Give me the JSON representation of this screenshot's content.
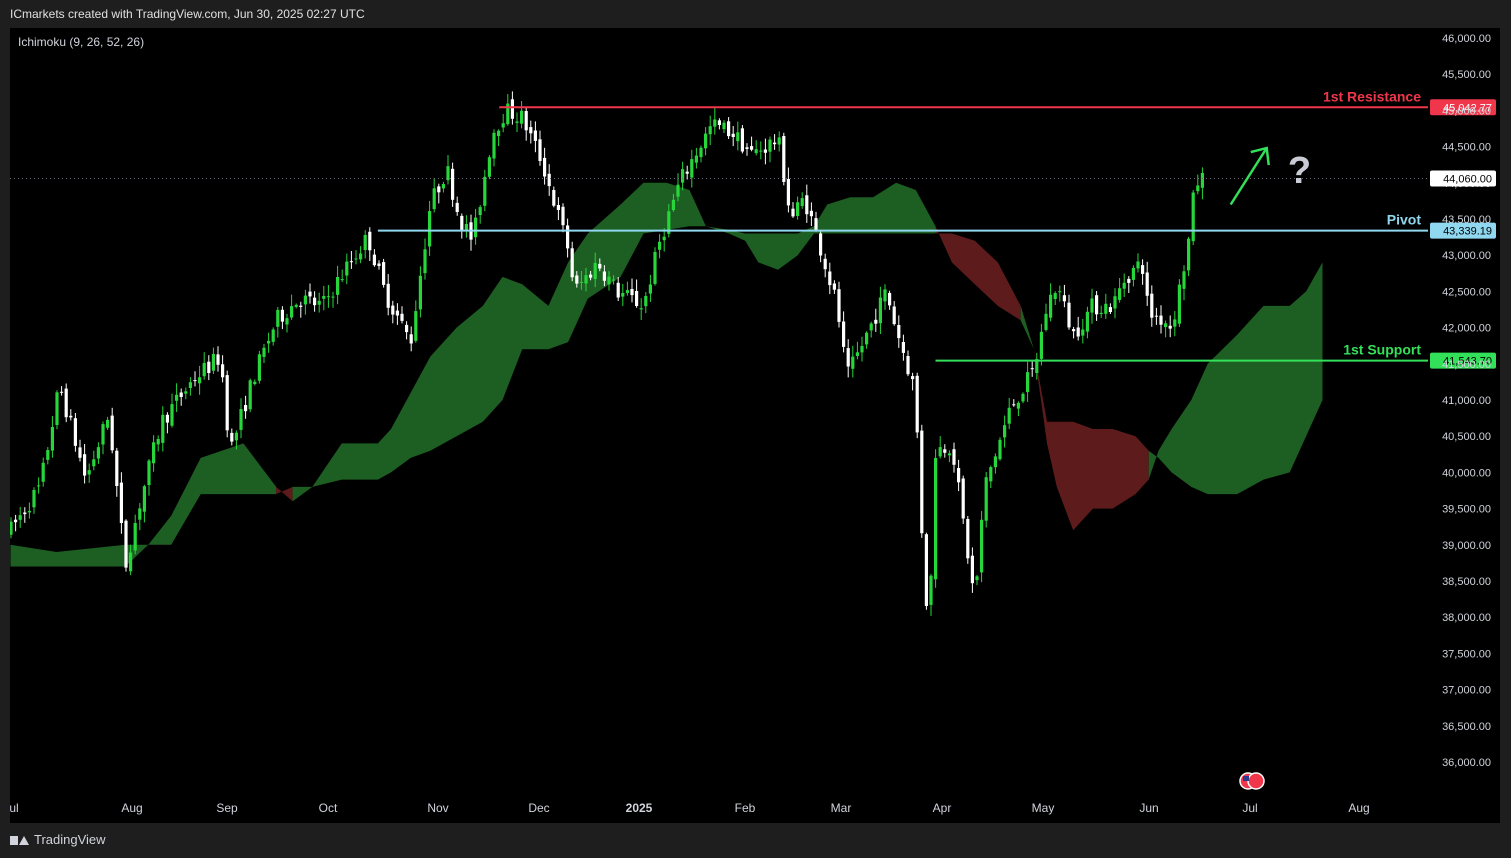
{
  "header": {
    "credit": "ICmarkets created with TradingView.com, Jun 30, 2025 02:27 UTC"
  },
  "footer": {
    "brand": "TradingView"
  },
  "icons": {
    "brand": "tradingview-logo-icon",
    "event": "us-flag-event-icon",
    "annotation": "question-mark-icon"
  },
  "colors": {
    "background": "#000000",
    "bull_candle": "#26d63a",
    "bear_candle": "#ffffff",
    "cloud_bull": "#1d5e22",
    "cloud_bear": "#5e1b1b",
    "resistance": "#f0364a",
    "pivot": "#8fd8f0",
    "support": "#33e05a",
    "arrow": "#33e05a"
  },
  "chart_data": {
    "type": "candlestick",
    "indicator": "Ichimoku (9, 26, 52, 26)",
    "ylim": [
      35700,
      46000
    ],
    "y_ticks": [
      "46,000.00",
      "45,500.00",
      "45,000.00",
      "44,500.00",
      "44,000.00",
      "43,500.00",
      "43,000.00",
      "42,500.00",
      "42,000.00",
      "41,500.00",
      "41,000.00",
      "40,500.00",
      "40,000.00",
      "39,500.00",
      "39,000.00",
      "38,500.00",
      "38,000.00",
      "37,500.00",
      "37,000.00",
      "36,500.00",
      "36,000.00"
    ],
    "x_ticks": [
      "Jul",
      "Aug",
      "Sep",
      "Oct",
      "Nov",
      "Dec",
      "2025",
      "Feb",
      "Mar",
      "Apr",
      "May",
      "Jun",
      "Jul",
      "Aug"
    ],
    "last_price": {
      "value": 44060,
      "label": "44,060.00"
    },
    "levels": [
      {
        "name": "1st Resistance",
        "value": 45042.77,
        "label": "45,042.77",
        "start_date": "2024-11-27"
      },
      {
        "name": "Pivot",
        "value": 43339.19,
        "label": "43,339.19",
        "start_date": "2024-10-21"
      },
      {
        "name": "1st Support",
        "value": 41543.7,
        "label": "41,543.70",
        "start_date": "2025-04-09"
      }
    ],
    "annotations": [
      {
        "type": "arrow",
        "from": [
          "2025-07-08",
          43700
        ],
        "to": [
          "2025-07-19",
          44480
        ]
      },
      {
        "type": "text",
        "text": "?",
        "at": [
          "2025-07-29",
          44000
        ]
      }
    ],
    "price_path": [
      [
        "2024-07-01",
        39200
      ],
      [
        "2024-07-10",
        39800
      ],
      [
        "2024-07-16",
        41200
      ],
      [
        "2024-07-24",
        39900
      ],
      [
        "2024-07-31",
        40800
      ],
      [
        "2024-08-05",
        38700
      ],
      [
        "2024-08-09",
        39500
      ],
      [
        "2024-08-16",
        40700
      ],
      [
        "2024-08-26",
        41300
      ],
      [
        "2024-09-03",
        41600
      ],
      [
        "2024-09-06",
        40300
      ],
      [
        "2024-09-13",
        41300
      ],
      [
        "2024-09-20",
        42100
      ],
      [
        "2024-09-27",
        42400
      ],
      [
        "2024-10-04",
        42300
      ],
      [
        "2024-10-11",
        42800
      ],
      [
        "2024-10-18",
        43250
      ],
      [
        "2024-10-23",
        42500
      ],
      [
        "2024-10-31",
        41800
      ],
      [
        "2024-11-06",
        43700
      ],
      [
        "2024-11-11",
        44200
      ],
      [
        "2024-11-15",
        43500
      ],
      [
        "2024-11-19",
        43200
      ],
      [
        "2024-11-25",
        44700
      ],
      [
        "2024-11-29",
        45000
      ],
      [
        "2024-12-04",
        44900
      ],
      [
        "2024-12-10",
        44300
      ],
      [
        "2024-12-18",
        43100
      ],
      [
        "2024-12-20",
        42500
      ],
      [
        "2024-12-27",
        42900
      ],
      [
        "2025-01-02",
        42500
      ],
      [
        "2025-01-10",
        42300
      ],
      [
        "2025-01-15",
        43200
      ],
      [
        "2025-01-21",
        44000
      ],
      [
        "2025-01-27",
        44500
      ],
      [
        "2025-01-31",
        44800
      ],
      [
        "2025-02-06",
        44700
      ],
      [
        "2025-02-12",
        44400
      ],
      [
        "2025-02-20",
        44600
      ],
      [
        "2025-02-24",
        43500
      ],
      [
        "2025-02-28",
        43800
      ],
      [
        "2025-03-05",
        43100
      ],
      [
        "2025-03-10",
        42300
      ],
      [
        "2025-03-13",
        41300
      ],
      [
        "2025-03-19",
        41900
      ],
      [
        "2025-03-25",
        42500
      ],
      [
        "2025-03-28",
        42000
      ],
      [
        "2025-04-03",
        41100
      ],
      [
        "2025-04-04",
        39800
      ],
      [
        "2025-04-07",
        37700
      ],
      [
        "2025-04-09",
        40300
      ],
      [
        "2025-04-14",
        40400
      ],
      [
        "2025-04-21",
        38200
      ],
      [
        "2025-04-24",
        39800
      ],
      [
        "2025-05-02",
        40900
      ],
      [
        "2025-05-09",
        41400
      ],
      [
        "2025-05-13",
        42300
      ],
      [
        "2025-05-16",
        42600
      ],
      [
        "2025-05-21",
        41900
      ],
      [
        "2025-05-27",
        42300
      ],
      [
        "2025-06-02",
        42300
      ],
      [
        "2025-06-06",
        42700
      ],
      [
        "2025-06-11",
        42900
      ],
      [
        "2025-06-13",
        42200
      ],
      [
        "2025-06-18",
        42100
      ],
      [
        "2025-06-20",
        42000
      ],
      [
        "2025-06-24",
        42900
      ],
      [
        "2025-06-26",
        43400
      ],
      [
        "2025-06-27",
        44000
      ],
      [
        "2025-06-30",
        44060
      ]
    ],
    "cloud": [
      {
        "date": "2024-07-01",
        "a": 39000,
        "b": 38700
      },
      {
        "date": "2024-07-15",
        "a": 38900,
        "b": 38700
      },
      {
        "date": "2024-08-05",
        "a": 39000,
        "b": 38700
      },
      {
        "date": "2024-08-12",
        "a": 39000,
        "b": 39000
      },
      {
        "date": "2024-08-19",
        "a": 39400,
        "b": 39000
      },
      {
        "date": "2024-08-28",
        "a": 40200,
        "b": 39700
      },
      {
        "date": "2024-09-10",
        "a": 40400,
        "b": 39700
      },
      {
        "date": "2024-09-20",
        "a": 39800,
        "b": 39700
      },
      {
        "date": "2024-09-25",
        "a": 39600,
        "b": 39800
      },
      {
        "date": "2024-10-01",
        "a": 39800,
        "b": 39800
      },
      {
        "date": "2024-10-10",
        "a": 40400,
        "b": 39900
      },
      {
        "date": "2024-10-21",
        "a": 40400,
        "b": 39900
      },
      {
        "date": "2024-10-25",
        "a": 40600,
        "b": 40000
      },
      {
        "date": "2024-10-31",
        "a": 41100,
        "b": 40200
      },
      {
        "date": "2024-11-06",
        "a": 41600,
        "b": 40300
      },
      {
        "date": "2024-11-14",
        "a": 42000,
        "b": 40500
      },
      {
        "date": "2024-11-22",
        "a": 42300,
        "b": 40700
      },
      {
        "date": "2024-11-28",
        "a": 42700,
        "b": 41000
      },
      {
        "date": "2024-12-04",
        "a": 42600,
        "b": 41700
      },
      {
        "date": "2024-12-12",
        "a": 42300,
        "b": 41700
      },
      {
        "date": "2024-12-18",
        "a": 42900,
        "b": 41800
      },
      {
        "date": "2024-12-24",
        "a": 43300,
        "b": 42400
      },
      {
        "date": "2025-01-03",
        "a": 43700,
        "b": 42700
      },
      {
        "date": "2025-01-10",
        "a": 44000,
        "b": 43300
      },
      {
        "date": "2025-01-17",
        "a": 44000,
        "b": 43350
      },
      {
        "date": "2025-01-24",
        "a": 43900,
        "b": 43400
      },
      {
        "date": "2025-01-29",
        "a": 43400,
        "b": 43400
      },
      {
        "date": "2025-02-05",
        "a": 43350,
        "b": 43300
      },
      {
        "date": "2025-02-10",
        "a": 43300,
        "b": 43200
      },
      {
        "date": "2025-02-14",
        "a": 43300,
        "b": 42900
      },
      {
        "date": "2025-02-20",
        "a": 43300,
        "b": 42800
      },
      {
        "date": "2025-02-26",
        "a": 43300,
        "b": 43000
      },
      {
        "date": "2025-03-03",
        "a": 43400,
        "b": 43300
      },
      {
        "date": "2025-03-07",
        "a": 43700,
        "b": 43300
      },
      {
        "date": "2025-03-14",
        "a": 43800,
        "b": 43300
      },
      {
        "date": "2025-03-21",
        "a": 43800,
        "b": 43300
      },
      {
        "date": "2025-03-28",
        "a": 44000,
        "b": 43300
      },
      {
        "date": "2025-04-03",
        "a": 43900,
        "b": 43300
      },
      {
        "date": "2025-04-09",
        "a": 43400,
        "b": 43300
      },
      {
        "date": "2025-04-14",
        "a": 42900,
        "b": 43300
      },
      {
        "date": "2025-04-21",
        "a": 42600,
        "b": 43200
      },
      {
        "date": "2025-04-28",
        "a": 42300,
        "b": 42900
      },
      {
        "date": "2025-05-05",
        "a": 42100,
        "b": 42300
      },
      {
        "date": "2025-05-09",
        "a": 41700,
        "b": 41700
      },
      {
        "date": "2025-05-13",
        "a": 40400,
        "b": 40700
      },
      {
        "date": "2025-05-16",
        "a": 39800,
        "b": 40700
      },
      {
        "date": "2025-05-21",
        "a": 39200,
        "b": 40700
      },
      {
        "date": "2025-05-27",
        "a": 39500,
        "b": 40600
      },
      {
        "date": "2025-06-02",
        "a": 39500,
        "b": 40600
      },
      {
        "date": "2025-06-09",
        "a": 39700,
        "b": 40500
      },
      {
        "date": "2025-06-13",
        "a": 39900,
        "b": 40300
      },
      {
        "date": "2025-06-16",
        "a": 40300,
        "b": 40200
      },
      {
        "date": "2025-06-20",
        "a": 40600,
        "b": 40000
      },
      {
        "date": "2025-06-26",
        "a": 41000,
        "b": 39800
      },
      {
        "date": "2025-07-01",
        "a": 41500,
        "b": 39700
      },
      {
        "date": "2025-07-10",
        "a": 41900,
        "b": 39700
      },
      {
        "date": "2025-07-18",
        "a": 42300,
        "b": 39900
      },
      {
        "date": "2025-07-26",
        "a": 42300,
        "b": 40000
      },
      {
        "date": "2025-07-31",
        "a": 42500,
        "b": 40500
      },
      {
        "date": "2025-08-05",
        "a": 42900,
        "b": 41000
      }
    ]
  }
}
